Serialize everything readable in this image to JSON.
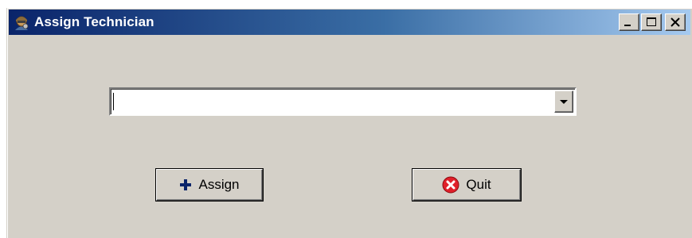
{
  "window": {
    "title": "Assign Technician",
    "icon": "technician-app-icon",
    "controls": {
      "minimize_icon": "minimize-icon",
      "maximize_icon": "maximize-icon",
      "close_icon": "close-icon"
    }
  },
  "technician_select": {
    "value": "",
    "placeholder": "",
    "arrow_icon": "chevron-down-icon"
  },
  "buttons": {
    "assign": {
      "label": "Assign",
      "icon": "plus-icon",
      "icon_color": "#0a246a"
    },
    "quit": {
      "label": "Quit",
      "icon": "x-circle-icon",
      "icon_color": "#e0202a"
    }
  },
  "colors": {
    "titlebar_start": "#0a246a",
    "titlebar_end": "#a6caf0",
    "window_bg": "#d4d0c8"
  }
}
